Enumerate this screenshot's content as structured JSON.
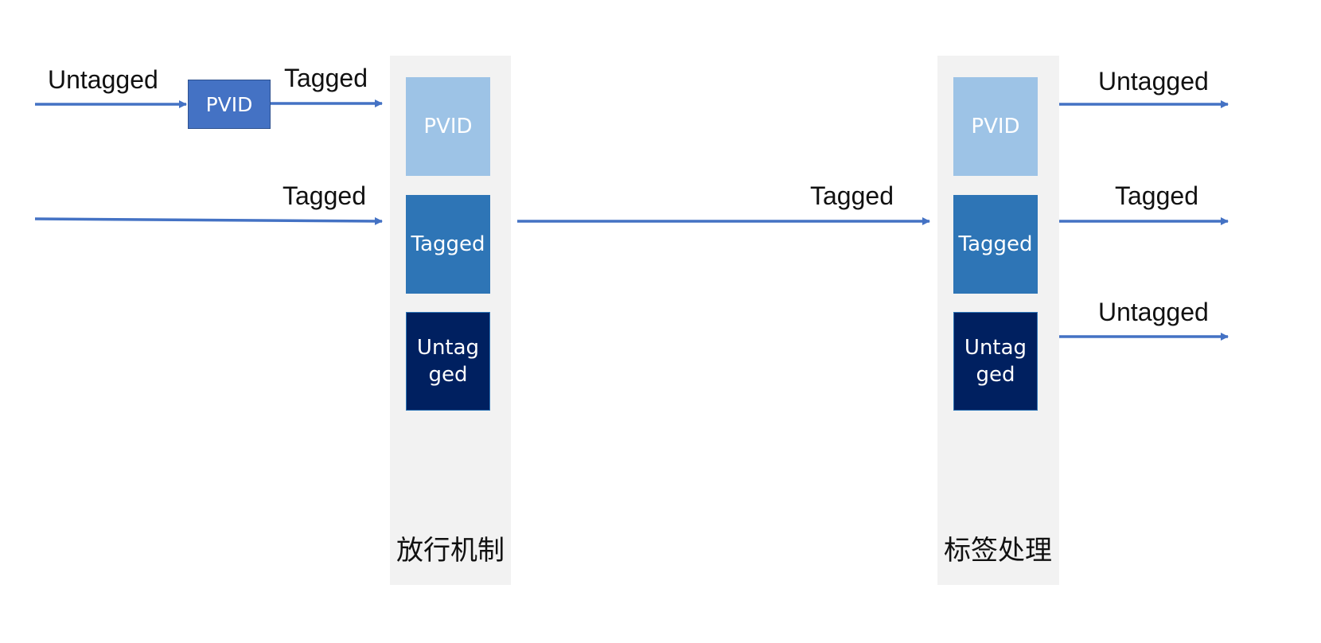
{
  "columns": {
    "left": {
      "caption": "放行机制",
      "boxes": {
        "pvid": "PVID",
        "tagged": "Tagged",
        "untagged": "Untagged"
      }
    },
    "right": {
      "caption": "标签处理",
      "boxes": {
        "pvid": "PVID",
        "tagged": "Tagged",
        "untagged": "Untagged"
      }
    }
  },
  "ingress": {
    "untagged_label": "Untagged",
    "pvid_box": "PVID",
    "tagged_after_pvid_label": "Tagged",
    "tagged_label": "Tagged"
  },
  "middle": {
    "tagged_label": "Tagged"
  },
  "egress": {
    "untagged_top_label": "Untagged",
    "tagged_label": "Tagged",
    "untagged_bottom_label": "Untagged"
  },
  "colors": {
    "arrow": "#4472c4",
    "pvid_light": "#9dc3e6",
    "tagged_mid": "#2e75b6",
    "untagged_dark": "#002060",
    "column_bg": "#f2f2f2"
  }
}
